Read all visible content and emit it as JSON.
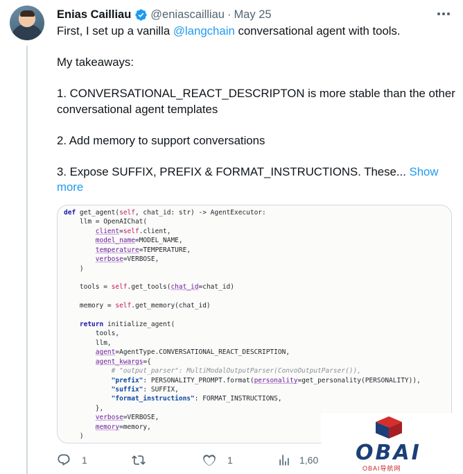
{
  "tweet": {
    "display_name": "Enias Cailliau",
    "handle": "@eniascailliau",
    "separator": "·",
    "date": "May 25",
    "text_intro_before": "First, I set up a vanilla ",
    "text_intro_mention": "@langchain",
    "text_intro_after": " conversational agent with tools.",
    "takeaways_heading": "My takeaways:",
    "point_1": "1. CONVERSATIONAL_REACT_DESCRIPTON is more stable than the other conversational agent templates",
    "point_2": "2. Add memory to support conversations",
    "point_3": "3. Expose SUFFIX, PREFIX & FORMAT_INSTRUCTIONS. These...",
    "show_more": "Show more"
  },
  "code_snippet": {
    "lines": [
      "def get_agent(self, chat_id: str) -> AgentExecutor:",
      "    llm = OpenAIChat(",
      "        client=self.client,",
      "        model_name=MODEL_NAME,",
      "        temperature=TEMPERATURE,",
      "        verbose=VERBOSE,",
      "    )",
      "",
      "    tools = self.get_tools(chat_id=chat_id)",
      "",
      "    memory = self.get_memory(chat_id)",
      "",
      "    return initialize_agent(",
      "        tools,",
      "        llm,",
      "        agent=AgentType.CONVERSATIONAL_REACT_DESCRIPTION,",
      "        agent_kwargs={",
      "            # \"output_parser\": MultiModalOutputParser(ConvoOutputParser()),",
      "            \"prefix\": PERSONALITY_PROMPT.format(personality=get_personality(PERSONALITY)),",
      "            \"suffix\": SUFFIX,",
      "            \"format_instructions\": FORMAT_INSTRUCTIONS,",
      "        },",
      "        verbose=VERBOSE,",
      "        memory=memory,",
      "    )"
    ]
  },
  "actions": {
    "reply_count": "1",
    "retweet_count": "",
    "like_count": "1",
    "view_count": "1,60"
  },
  "watermark": {
    "brand": "OBAI",
    "subtitle": "OBAI导航网"
  },
  "colors": {
    "link": "#1d9bf0",
    "muted": "#536471",
    "verified": "#1d9bf0",
    "text": "#0f1419"
  },
  "icons": [
    "verified-badge-icon",
    "more-options-icon",
    "reply-icon",
    "retweet-icon",
    "like-icon",
    "views-icon"
  ]
}
